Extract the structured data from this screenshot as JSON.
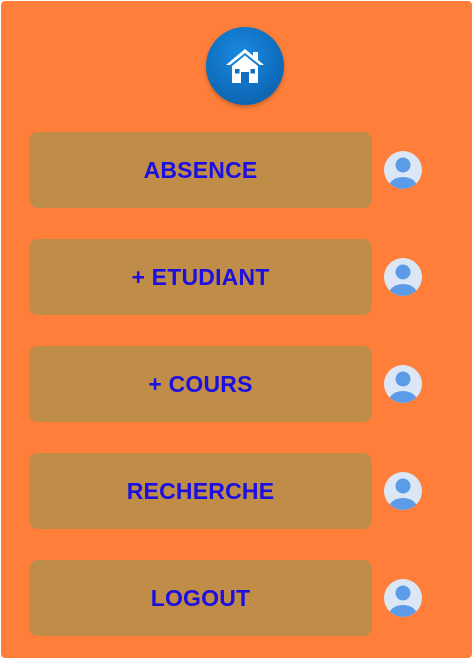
{
  "colors": {
    "background": "#ff7f3a",
    "button_fill": "#bf8d48",
    "button_text": "#1c0fe0",
    "home_blue": "#0f6fc0",
    "avatar_bg": "#dce7f6",
    "avatar_figure": "#5b9be8"
  },
  "header": {
    "home_icon": "home-icon"
  },
  "menu": {
    "items": [
      {
        "label": "ABSENCE",
        "icon": "user-avatar-icon"
      },
      {
        "label": "+ ETUDIANT",
        "icon": "user-avatar-icon"
      },
      {
        "label": "+ COURS",
        "icon": "user-avatar-icon"
      },
      {
        "label": "RECHERCHE",
        "icon": "user-avatar-icon"
      },
      {
        "label": "LOGOUT",
        "icon": "user-avatar-icon"
      }
    ]
  }
}
